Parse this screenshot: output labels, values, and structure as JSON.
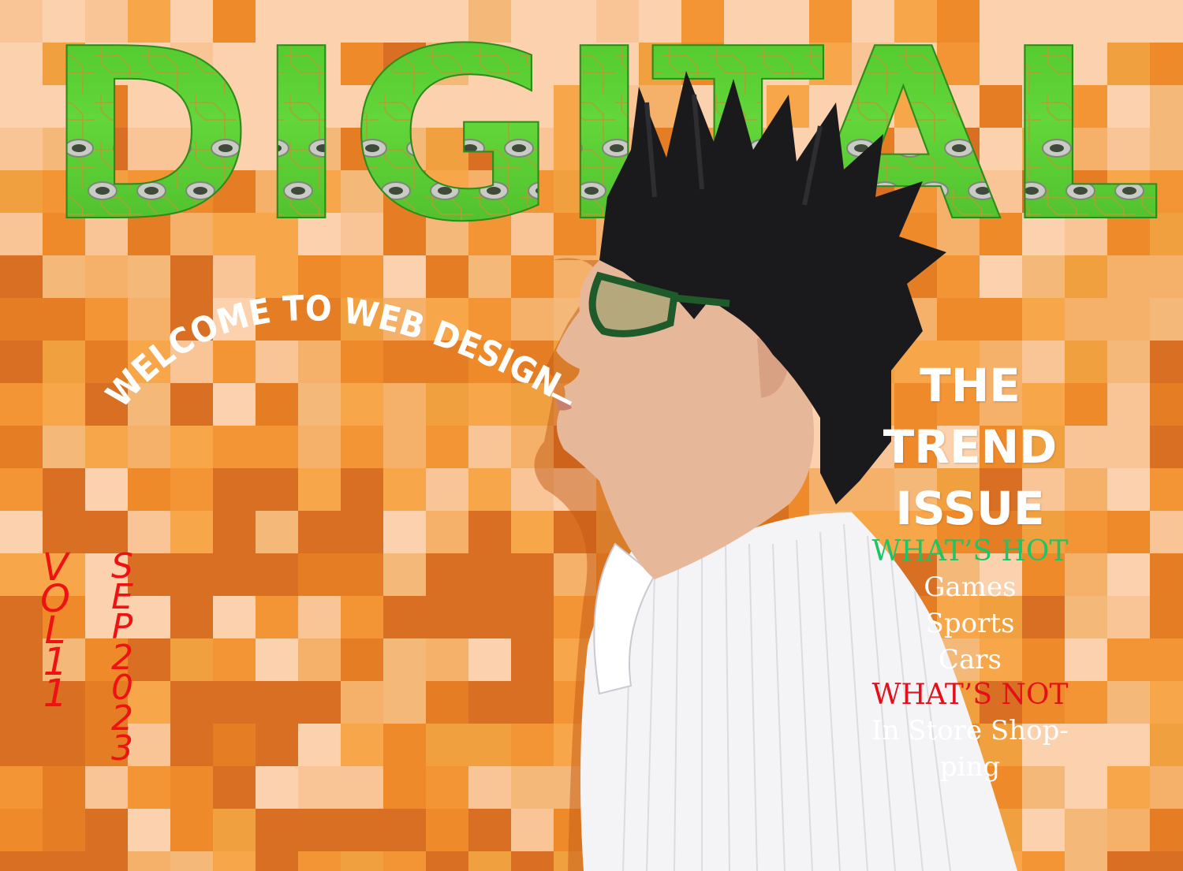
{
  "masthead": {
    "title": "DIGITAL"
  },
  "welcome_arc": "WELCOME TO WEB DESIGN",
  "cover_lines": {
    "headline": [
      "THE",
      "TREND",
      "ISSUE"
    ],
    "hot_heading": "WHAT’S HOT",
    "hot_items": [
      "Games",
      "Sports",
      "Cars"
    ],
    "not_heading": "WHAT’S NOT",
    "not_items": [
      "In Store Shop-",
      "ping"
    ]
  },
  "volume": "VOL11",
  "issue_date": "SEP2023",
  "colors": {
    "background": "#f0942a",
    "masthead_green": "#5bd132",
    "hot": "#1ec466",
    "not": "#e3101a",
    "vertical_text": "#ee1212"
  }
}
